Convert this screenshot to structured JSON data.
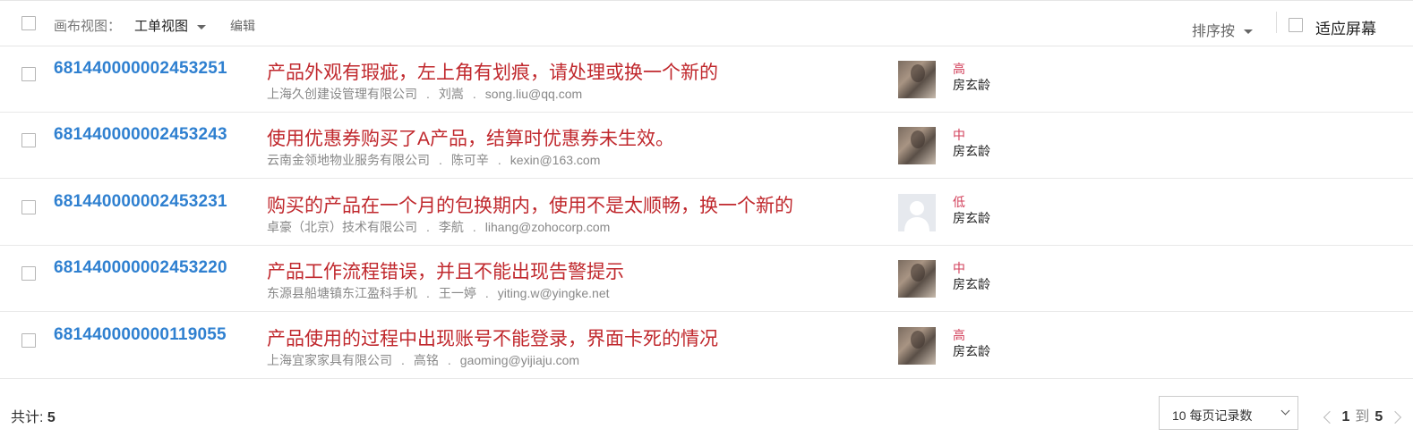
{
  "toolbar": {
    "canvas_view_label": "画布视图：",
    "view_name": "工单视图",
    "edit_label": "编辑",
    "sort_label": "排序按",
    "fit_screen_label": "适应屏幕"
  },
  "tickets": [
    {
      "id": "681440000002453251",
      "subject": "产品外观有瑕疵，左上角有划痕，请处理或换一个新的",
      "company": "上海久创建设管理有限公司",
      "contact": "刘嵩",
      "email": "song.liu@qq.com",
      "priority": "高",
      "assignee": "房玄龄",
      "avatar": "photo"
    },
    {
      "id": "681440000002453243",
      "subject": "使用优惠券购买了A产品，结算时优惠券未生效。",
      "company": "云南金领地物业服务有限公司",
      "contact": "陈可辛",
      "email": "kexin@163.com",
      "priority": "中",
      "assignee": "房玄龄",
      "avatar": "photo"
    },
    {
      "id": "681440000002453231",
      "subject": "购买的产品在一个月的包换期内，使用不是太顺畅，换一个新的",
      "company": "卓豪（北京）技术有限公司",
      "contact": "李航",
      "email": "lihang@zohocorp.com",
      "priority": "低",
      "assignee": "房玄龄",
      "avatar": "blank"
    },
    {
      "id": "681440000002453220",
      "subject": "产品工作流程错误，并且不能出现告警提示",
      "company": "东源县船塘镇东江盈科手机",
      "contact": "王一婷",
      "email": "yiting.w@yingke.net",
      "priority": "中",
      "assignee": "房玄龄",
      "avatar": "photo"
    },
    {
      "id": "681440000000119055",
      "subject": "产品使用的过程中出现账号不能登录，界面卡死的情况",
      "company": "上海宜家家具有限公司",
      "contact": "高铭",
      "email": "gaoming@yijiaju.com",
      "priority": "高",
      "assignee": "房玄龄",
      "avatar": "photo"
    }
  ],
  "meta_separator": ".",
  "footer": {
    "total_label": "共计:",
    "total_count": "5",
    "per_page_label": "10 每页记录数",
    "page_from": "1",
    "page_to_label": "到",
    "page_to": "5"
  },
  "colors": {
    "ticket_id": "#2f80d0",
    "subject": "#c0282d",
    "priority": "#d23f5a"
  }
}
